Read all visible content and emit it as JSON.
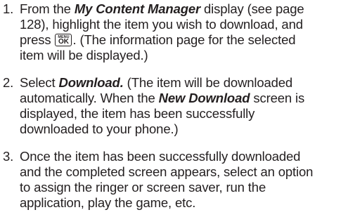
{
  "steps": [
    {
      "number": "1.",
      "l1a": "From the ",
      "l1b": "My Content Manager",
      "l1c": " display (see page",
      "l2": "128), highlight the item you wish to download, and",
      "l3a": "press ",
      "l3b": ". (The information page for the selected",
      "l4": "item will be displayed.)",
      "key_top": "MENU",
      "key_main": "OK"
    },
    {
      "number": "2.",
      "l1a": "Select ",
      "l1b": "Download.",
      "l1c": " (The item will be downloaded",
      "l2a": "automatically. When the ",
      "l2b": "New Download",
      "l2c": " screen is",
      "l3": "displayed, the item has been successfully",
      "l4": "downloaded to your phone.)"
    },
    {
      "number": "3.",
      "l1": "Once the item has been successfully downloaded",
      "l2": "and the completed screen appears, select an option",
      "l3": "to assign the ringer or screen saver, run the",
      "l4": "application, play the game, etc."
    }
  ]
}
